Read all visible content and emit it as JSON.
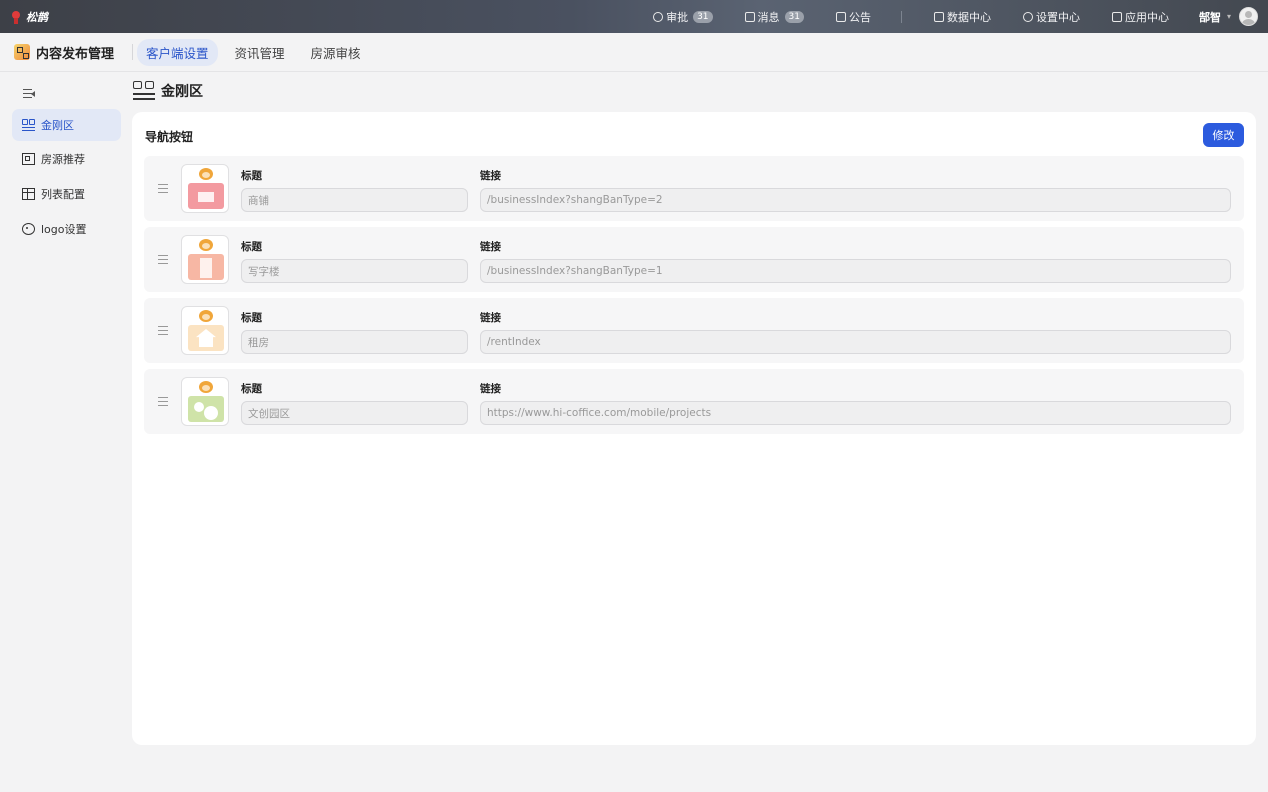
{
  "topbar": {
    "brand": "松鹊",
    "items": [
      {
        "label": "审批",
        "icon": "user-icon",
        "badge": "31"
      },
      {
        "label": "消息",
        "icon": "message-icon",
        "badge": "31"
      },
      {
        "label": "公告",
        "icon": "speaker-icon",
        "badge": null
      },
      {
        "label": "数据中心",
        "icon": "data-icon",
        "badge": null
      },
      {
        "label": "设置中心",
        "icon": "gear-icon",
        "badge": null
      },
      {
        "label": "应用中心",
        "icon": "apps-icon",
        "badge": null
      }
    ],
    "user": "郜智"
  },
  "subheader": {
    "module_title": "内容发布管理",
    "tabs": [
      {
        "label": "客户端设置",
        "active": true
      },
      {
        "label": "资讯管理",
        "active": false
      },
      {
        "label": "房源审核",
        "active": false
      }
    ]
  },
  "sidebar": {
    "items": [
      {
        "label": "金刚区",
        "icon": "grid-icon",
        "active": true
      },
      {
        "label": "房源推荐",
        "icon": "building-icon",
        "active": false
      },
      {
        "label": "列表配置",
        "icon": "table-icon",
        "active": false
      },
      {
        "label": "logo设置",
        "icon": "palette-icon",
        "active": false
      }
    ]
  },
  "page": {
    "title": "金刚区",
    "section_title": "导航按钮",
    "edit_label": "修改",
    "title_field_label": "标题",
    "link_field_label": "链接",
    "nav_items": [
      {
        "title": "商铺",
        "link": "/businessIndex?shangBanType=2",
        "image": "shop"
      },
      {
        "title": "写字楼",
        "link": "/businessIndex?shangBanType=1",
        "image": "office"
      },
      {
        "title": "租房",
        "link": "/rentIndex",
        "image": "home"
      },
      {
        "title": "文创园区",
        "link": "https://www.hi-coffice.com/mobile/projects",
        "image": "park"
      }
    ]
  },
  "colors": {
    "accent": "#2c5bde",
    "active_bg": "#e2e8f6"
  }
}
